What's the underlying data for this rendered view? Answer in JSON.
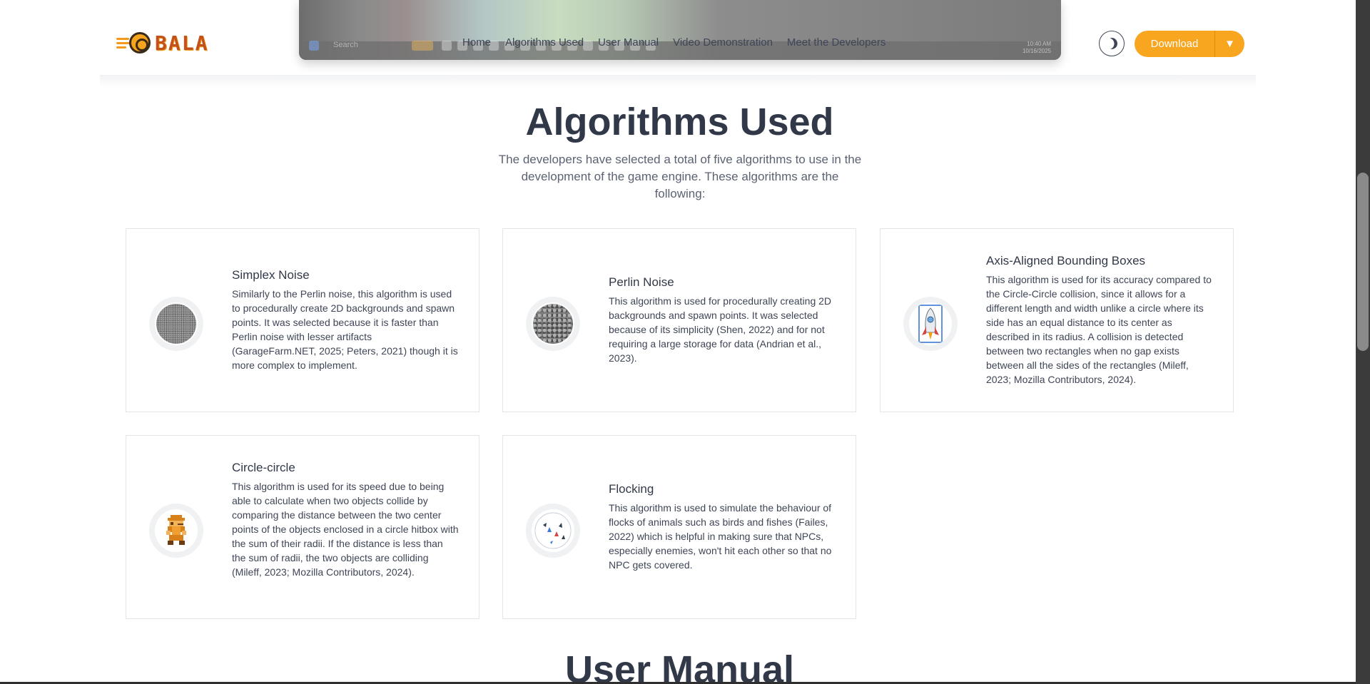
{
  "brand": {
    "name": "BALA"
  },
  "nav": {
    "items": [
      "Home",
      "Algorithms Used",
      "User Manual",
      "Video Demonstration",
      "Meet the Developers"
    ]
  },
  "header": {
    "download_label": "Download",
    "download_caret": "▼",
    "theme_icon": "moon-icon"
  },
  "preview": {
    "search_placeholder": "Search",
    "time": "10:40 AM",
    "date": "10/16/2025"
  },
  "section": {
    "title": "Algorithms Used",
    "subtitle": "The developers have selected a total of five algorithms to use in the development of the game engine. These algorithms are the following:"
  },
  "cards": [
    {
      "title": "Simplex Noise",
      "icon": "simplex-noise-icon",
      "body": "Similarly to the Perlin noise, this algorithm is used to procedurally create 2D backgrounds and spawn points. It was selected because it is faster than Perlin noise with lesser artifacts (GarageFarm.NET, 2025; Peters, 2021) though it is more complex to implement."
    },
    {
      "title": "Perlin Noise",
      "icon": "perlin-noise-icon",
      "body": "This algorithm is used for procedurally creating 2D backgrounds and spawn points. It was selected because of its simplicity (Shen, 2022) and for not requiring a large storage for data (Andrian et al., 2023)."
    },
    {
      "title": "Axis-Aligned Bounding Boxes",
      "icon": "rocket-icon",
      "body": "This algorithm is used for its accuracy compared to the Circle-Circle collision, since it allows for a different length and width unlike a circle where its side has an equal distance to its center as described in its radius. A collision is detected between two rectangles when no gap exists between all the sides of the rectangles (Mileff, 2023; Mozilla Contributors, 2024)."
    },
    {
      "title": "Circle-circle",
      "icon": "mario-sprite-icon",
      "body": "This algorithm is used for its speed due to being able to calculate when two objects collide by comparing the distance between the two center points of the objects enclosed in a circle hitbox with the sum of their radii. If the distance is less than the sum of radii, the two objects are colliding (Mileff, 2023; Mozilla Contributors, 2024)."
    },
    {
      "title": "Flocking",
      "icon": "flocking-birds-icon",
      "body": "This algorithm is used to simulate the behaviour of flocks of animals such as birds and fishes (Failes, 2022) which is helpful in making sure that NPCs, especially enemies, won't hit each other so that no NPC gets covered."
    }
  ],
  "next_section": {
    "title": "User Manual"
  },
  "colors": {
    "accent": "#f8a51f",
    "text": "#313848",
    "card_border": "#e2e4e8"
  }
}
